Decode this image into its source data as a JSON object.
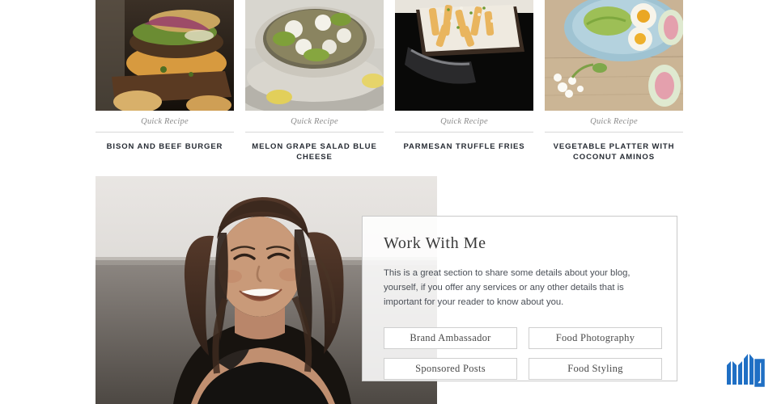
{
  "recipes": {
    "cards": [
      {
        "kicker": "Quick Recipe",
        "title": "BISON AND BEEF BURGER",
        "image_name": "burger-photo"
      },
      {
        "kicker": "Quick Recipe",
        "title": "MELON GRAPE SALAD BLUE CHEESE",
        "image_name": "salad-bowl-photo"
      },
      {
        "kicker": "Quick Recipe",
        "title": "PARMESAN TRUFFLE FRIES",
        "image_name": "truffle-fries-photo"
      },
      {
        "kicker": "Quick Recipe",
        "title": "VEGETABLE PLATTER WITH COCONUT AMINOS",
        "image_name": "vegetable-platter-photo"
      }
    ]
  },
  "work_with_me": {
    "title": "Work With Me",
    "body": "This is a great section to share some details about your blog, yourself, if you offer any services or any other details that is important for your reader to know about you.",
    "buttons": [
      "Brand Ambassador",
      "Food Photography",
      "Sponsored Posts",
      "Food Styling"
    ],
    "portrait_alt": "smiling-woman-portrait"
  },
  "logo": {
    "text": "MMO",
    "color": "#1f6fc4"
  },
  "colors": {
    "text_dark": "#262b33",
    "text_body": "#4a4f57",
    "muted": "#8c8c8c",
    "divider": "#d8d8d8",
    "border": "#c9c9c9",
    "background": "#ffffff"
  }
}
